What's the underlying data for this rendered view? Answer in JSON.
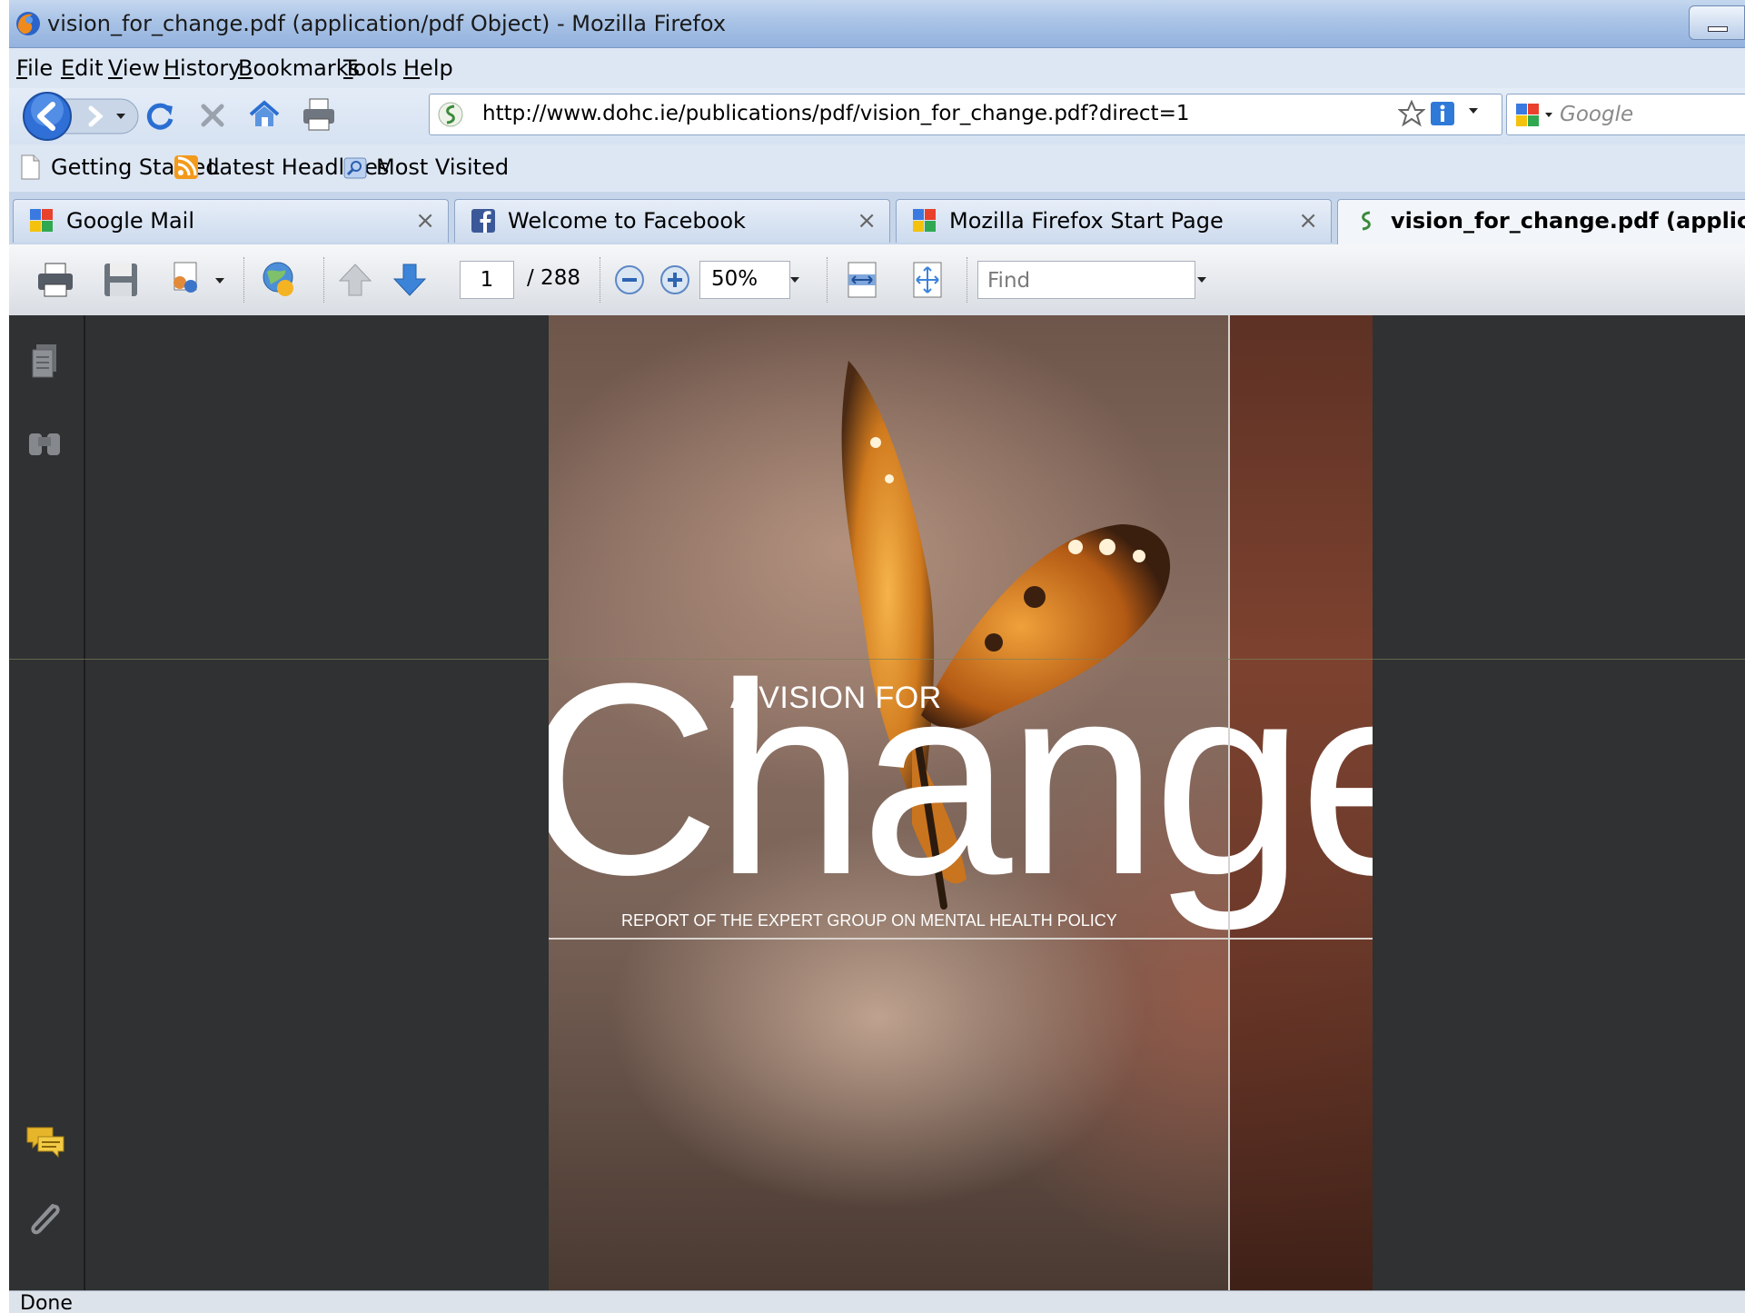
{
  "window": {
    "title": "vision_for_change.pdf (application/pdf Object) - Mozilla Firefox"
  },
  "menu": {
    "items": [
      "File",
      "Edit",
      "View",
      "History",
      "Bookmarks",
      "Tools",
      "Help"
    ]
  },
  "nav": {
    "url": "http://www.dohc.ie/publications/pdf/vision_for_change.pdf?direct=1",
    "search_placeholder": "Google"
  },
  "bookmarks": {
    "items": [
      "Getting Started",
      "Latest Headlines",
      "Most Visited"
    ]
  },
  "tabs": [
    {
      "label": "Google Mail",
      "icon": "google-icon",
      "active": false
    },
    {
      "label": "Welcome to Facebook",
      "icon": "facebook-icon",
      "active": false
    },
    {
      "label": "Mozilla Firefox Start Page",
      "icon": "google-icon",
      "active": false
    },
    {
      "label": "vision_for_change.pdf (applicati...",
      "icon": "site-identity-icon",
      "active": true
    }
  ],
  "pdf_toolbar": {
    "page_current": "1",
    "page_total": "/ 288",
    "zoom": "50%",
    "find_placeholder": "Find"
  },
  "document": {
    "heading_small": "A VISION FOR",
    "heading_large": "Change",
    "subtitle": "REPORT OF THE EXPERT GROUP ON MENTAL HEALTH POLICY"
  },
  "status": {
    "text": "Done"
  },
  "colors": {
    "window_chrome": "#dfe8f5",
    "viewer_background": "#2f3132",
    "accent_blue": "#2f7ad8"
  }
}
